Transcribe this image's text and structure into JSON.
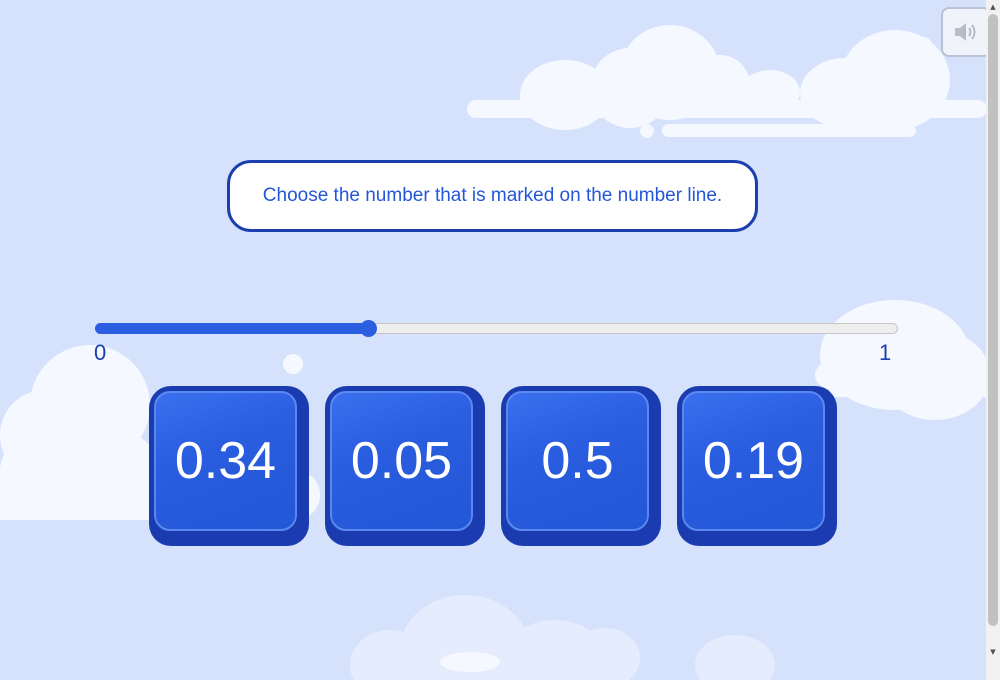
{
  "question": {
    "prompt": "Choose the number that is marked on the number line."
  },
  "number_line": {
    "min_label": "0",
    "max_label": "1",
    "marked_value": 0.34,
    "accent_color": "#2b5ee0"
  },
  "choices": [
    {
      "label": "0.34"
    },
    {
      "label": "0.05"
    },
    {
      "label": "0.5"
    },
    {
      "label": "0.19"
    }
  ],
  "sound_button": {
    "icon": "speaker-icon"
  },
  "colors": {
    "background": "#d6e2fb",
    "button_blue": "#2a5ddf",
    "button_border": "#1a3cb0",
    "prompt_text": "#2457d8"
  }
}
